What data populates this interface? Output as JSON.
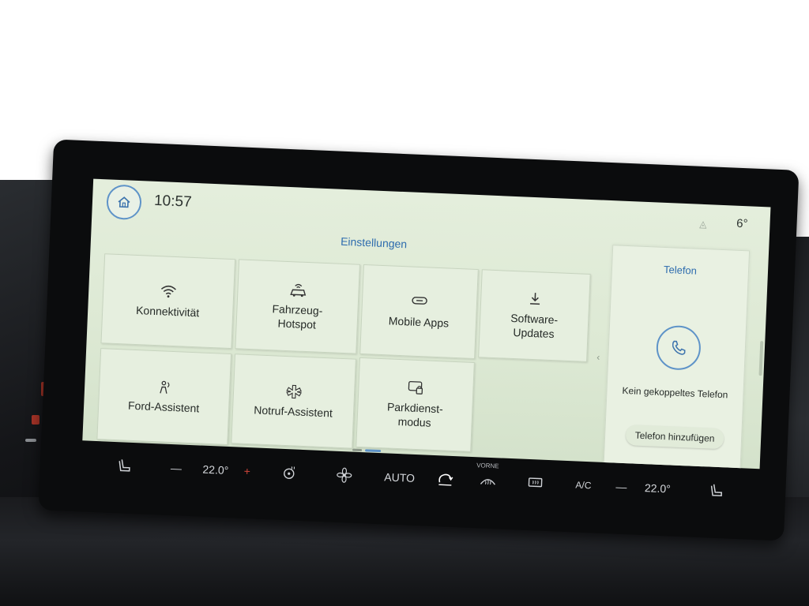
{
  "header": {
    "time": "10:57",
    "outside_temp": "6°"
  },
  "settings": {
    "title": "Einstellungen",
    "tiles": [
      {
        "label": "Konnektivität",
        "icon": "wifi-icon"
      },
      {
        "label": "Fahrzeug-\nHotspot",
        "icon": "car-hotspot-icon"
      },
      {
        "label": "Mobile Apps",
        "icon": "link-icon"
      },
      {
        "label": "Software-\nUpdates",
        "icon": "download-icon"
      },
      {
        "label": "Ford-Assistent",
        "icon": "assistant-icon"
      },
      {
        "label": "Notruf-Assistent",
        "icon": "emergency-icon"
      },
      {
        "label": "Parkdienst-\nmodus",
        "icon": "valet-icon"
      }
    ]
  },
  "phone_panel": {
    "title": "Telefon",
    "status": "Kein gekoppeltes Telefon",
    "add_button": "Telefon hinzufügen",
    "icon": "phone-icon"
  },
  "climate": {
    "driver_minus": "—",
    "driver_temp": "22.0°",
    "driver_plus": "+",
    "auto_label": "AUTO",
    "front_label": "VORNE",
    "ac_label": "A/C",
    "passenger_minus": "—",
    "passenger_temp": "22.0°"
  },
  "colors": {
    "accent": "#2e6cae",
    "screen_bg": "#e4eedc",
    "bezel": "#0b0c0d",
    "climate_text": "#d4d7db"
  }
}
